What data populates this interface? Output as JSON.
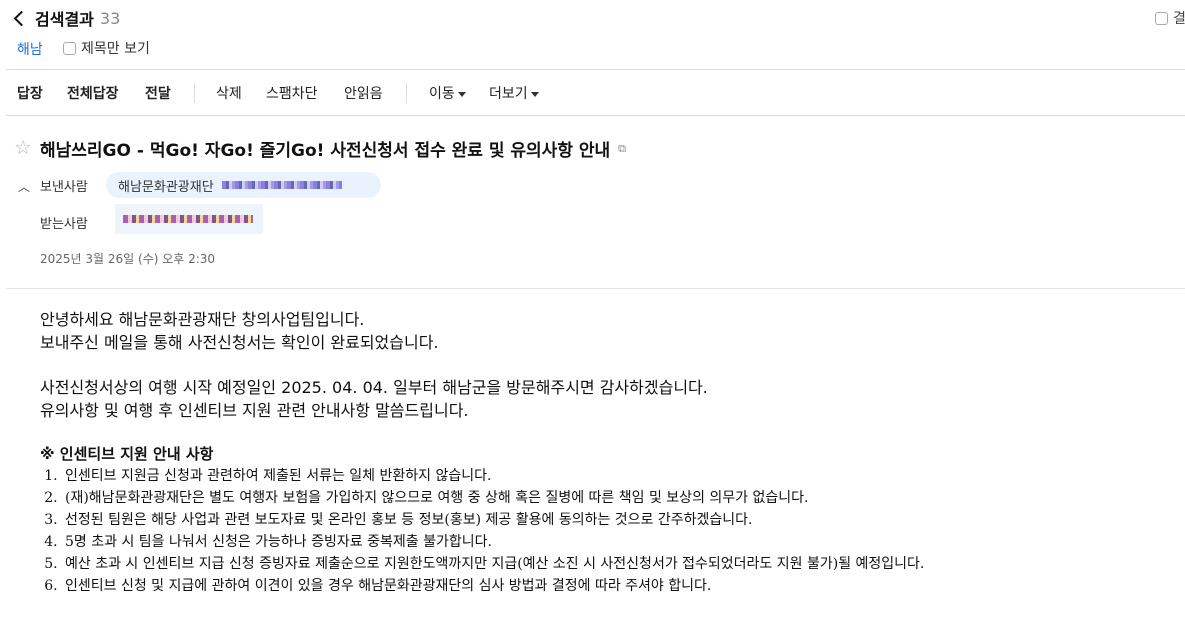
{
  "header": {
    "back_label": "검색결과",
    "result_count": "33",
    "right_label": "결",
    "search_keyword": "해남",
    "title_only_label": "제목만 보기"
  },
  "toolbar": {
    "reply": "답장",
    "reply_all": "전체답장",
    "forward": "전달",
    "delete": "삭제",
    "block_spam": "스팸차단",
    "mark_unread": "안읽음",
    "move": "이동",
    "more": "더보기"
  },
  "mail": {
    "subject": "해남쓰리GO - 먹Go! 자Go! 즐기Go! 사전신청서 접수 완료 및 유의사항 안내",
    "from_label": "보낸사람",
    "sender_name": "해남문화관광재단",
    "to_label": "받는사람",
    "date": "2025년 3월 26일 (수) 오후 2:30"
  },
  "body": {
    "greeting": "안녕하세요 해남문화관광재단 창의사업팀입니다.",
    "line2": "보내주신 메일을 통해 사전신청서는 확인이 완료되었습니다.",
    "line3": "사전신청서상의 여행 시작 예정일인  2025. 04. 04. 일부터 해남군을 방문해주시면 감사하겠습니다.",
    "line4": "유의사항 및 여행 후 인센티브 지원 관련 안내사항 말씀드립니다.",
    "notice_title": "※ 인센티브 지원 안내 사항",
    "items": [
      "인센티브 지원금 신청과 관련하여 제출된 서류는 일체 반환하지 않습니다.",
      "(재)해남문화관광재단은 별도 여행자 보험을 가입하지 않으므로 여행 중 상해 혹은 질병에 따른 책임 및 보상의 의무가 없습니다.",
      "선정된 팀원은 해당 사업과 관련 보도자료 및 온라인 홍보 등 정보(홍보) 제공 활용에 동의하는 것으로 간주하겠습니다.",
      "5명 초과 시 팀을 나눠서 신청은 가능하나 증빙자료 중복제출 불가합니다.",
      "예산 초과 시 인센티브 지급 신청 증빙자료 제출순으로 지원한도액까지만 지급(예산 소진 시 사전신청서가 접수되었더라도 지원 불가)될 예정입니다.",
      "인센티브 신청 및 지급에 관하여 이견이 있을 경우 해남문화관광재단의 심사 방법과 결정에 따라 주셔야 합니다."
    ]
  }
}
